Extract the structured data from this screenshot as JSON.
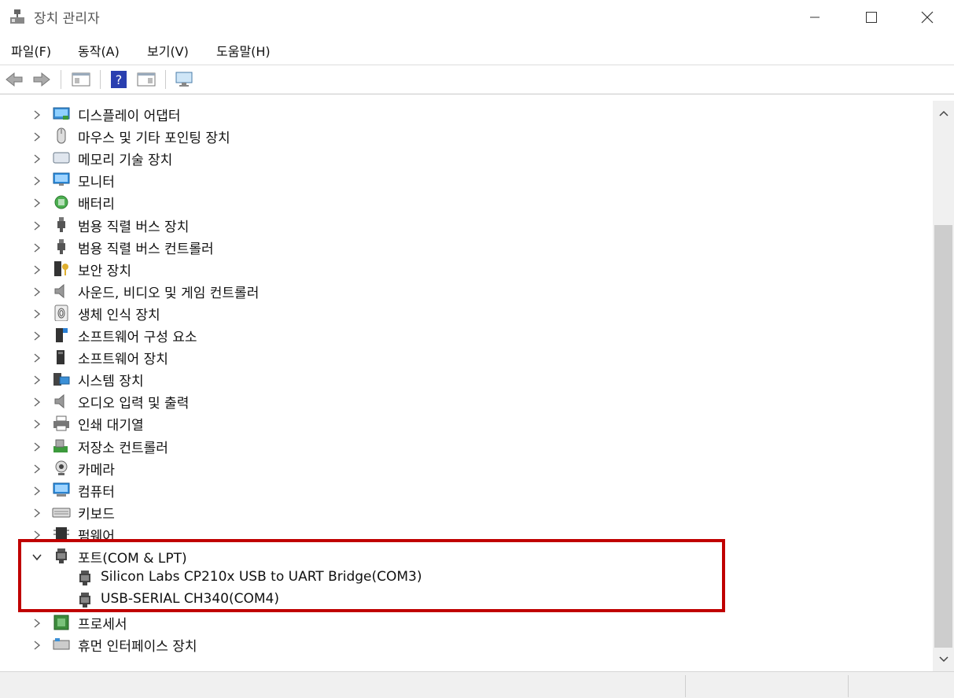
{
  "window": {
    "title": "장치 관리자"
  },
  "menu": [
    "파일(F)",
    "동작(A)",
    "보기(V)",
    "도움말(H)"
  ],
  "tree": [
    {
      "label": "디스플레이 어댑터",
      "icon": "display-adapter-icon"
    },
    {
      "label": "마우스 및 기타 포인팅 장치",
      "icon": "mouse-icon"
    },
    {
      "label": "메모리 기술 장치",
      "icon": "memory-device-icon"
    },
    {
      "label": "모니터",
      "icon": "monitor-icon"
    },
    {
      "label": "배터리",
      "icon": "battery-icon"
    },
    {
      "label": "범용 직렬 버스 장치",
      "icon": "usb-device-icon"
    },
    {
      "label": "범용 직렬 버스 컨트롤러",
      "icon": "usb-controller-icon"
    },
    {
      "label": "보안 장치",
      "icon": "security-device-icon"
    },
    {
      "label": "사운드, 비디오 및 게임 컨트롤러",
      "icon": "speaker-icon"
    },
    {
      "label": "생체 인식 장치",
      "icon": "fingerprint-icon"
    },
    {
      "label": "소프트웨어 구성 요소",
      "icon": "software-component-icon"
    },
    {
      "label": "소프트웨어 장치",
      "icon": "software-device-icon"
    },
    {
      "label": "시스템 장치",
      "icon": "system-device-icon"
    },
    {
      "label": "오디오 입력 및 출력",
      "icon": "speaker-icon"
    },
    {
      "label": "인쇄 대기열",
      "icon": "printer-icon"
    },
    {
      "label": "저장소 컨트롤러",
      "icon": "storage-controller-icon"
    },
    {
      "label": "카메라",
      "icon": "camera-icon"
    },
    {
      "label": "컴퓨터",
      "icon": "computer-icon"
    },
    {
      "label": "키보드",
      "icon": "keyboard-icon"
    },
    {
      "label": "펌웨어",
      "icon": "firmware-icon"
    },
    {
      "label": "포트(COM & LPT)",
      "icon": "port-icon",
      "expanded": true
    },
    {
      "label": "Silicon Labs CP210x USB to UART Bridge(COM3)",
      "icon": "port-icon",
      "child": true
    },
    {
      "label": "USB-SERIAL CH340(COM4)",
      "icon": "port-icon",
      "child": true
    },
    {
      "label": "프로세서",
      "icon": "processor-icon"
    },
    {
      "label": "휴먼 인터페이스 장치",
      "icon": "hid-icon"
    }
  ],
  "colors": {
    "highlight_border": "#c00000"
  }
}
